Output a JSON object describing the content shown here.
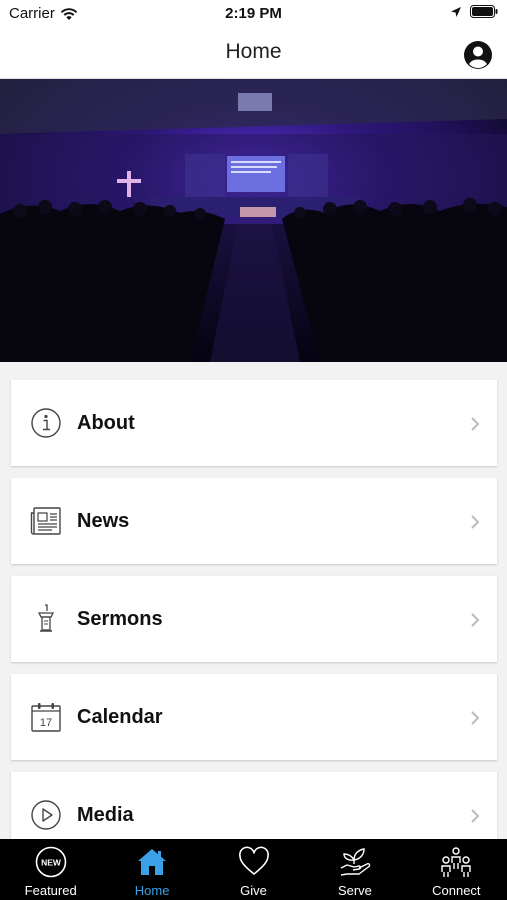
{
  "status": {
    "carrier": "Carrier",
    "time": "2:19 PM"
  },
  "nav": {
    "title": "Home"
  },
  "menu": [
    {
      "label": "About",
      "icon": "info-icon"
    },
    {
      "label": "News",
      "icon": "newspaper-icon"
    },
    {
      "label": "Sermons",
      "icon": "pulpit-icon"
    },
    {
      "label": "Calendar",
      "icon": "calendar-icon",
      "calendar_day": "17"
    },
    {
      "label": "Media",
      "icon": "play-icon"
    }
  ],
  "tabs": [
    {
      "label": "Featured",
      "icon": "new-badge-icon",
      "badge": "NEW"
    },
    {
      "label": "Home",
      "icon": "home-icon",
      "active": true
    },
    {
      "label": "Give",
      "icon": "heart-icon"
    },
    {
      "label": "Serve",
      "icon": "helping-hand-icon"
    },
    {
      "label": "Connect",
      "icon": "group-icon"
    }
  ],
  "colors": {
    "active_tab": "#3aa0e8",
    "tab_bar": "#000000",
    "background": "#f2f2f2"
  }
}
